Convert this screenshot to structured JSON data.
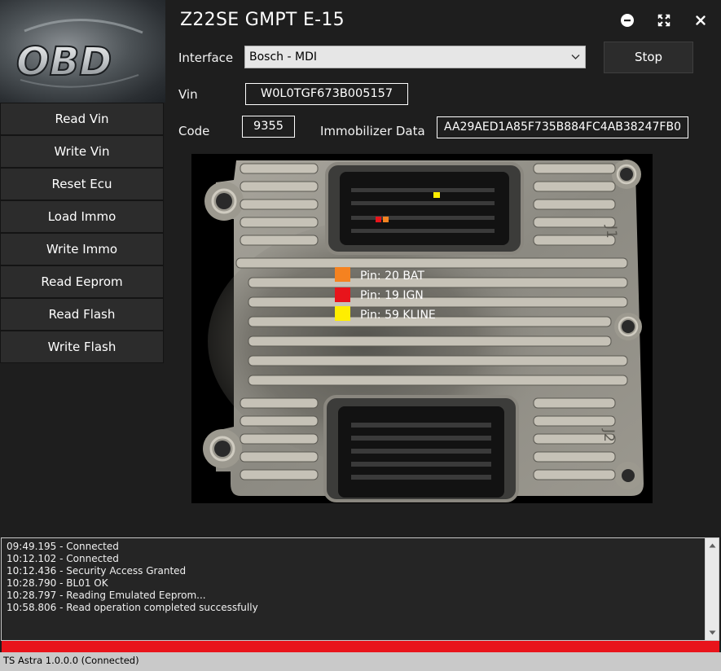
{
  "window": {
    "title": "Z22SE GMPT E-15",
    "minimize_icon": "minimize-circle-icon",
    "maximize_icon": "expand-arrows-icon",
    "close_icon": "close-x-icon"
  },
  "logo": {
    "text": "OBD"
  },
  "sidebar": {
    "items": [
      {
        "label": "Read Vin"
      },
      {
        "label": "Write Vin"
      },
      {
        "label": "Reset Ecu"
      },
      {
        "label": "Load Immo"
      },
      {
        "label": "Write Immo"
      },
      {
        "label": "Read Eeprom"
      },
      {
        "label": "Read Flash"
      },
      {
        "label": "Write Flash"
      }
    ]
  },
  "form": {
    "interface_label": "Interface",
    "interface_value": "Bosch - MDI",
    "stop_label": "Stop",
    "vin_label": "Vin",
    "vin_value": "W0L0TGF673B005157",
    "code_label": "Code",
    "code_value": "9355",
    "immo_label": "Immobilizer Data",
    "immo_value": "AA29AED1A85F735B884FC4AB38247FB0"
  },
  "ecu": {
    "connector_labels": [
      "J1",
      "J2"
    ],
    "legend": [
      {
        "label": "Pin: 20 BAT",
        "color": "#f58220"
      },
      {
        "label": "Pin: 19 IGN",
        "color": "#e8141b"
      },
      {
        "label": "Pin: 59 KLINE",
        "color": "#ffee00"
      }
    ]
  },
  "log": {
    "lines": [
      "09:49.195 - Connected",
      "10:12.102 - Connected",
      "10:12.436 - Security Access Granted",
      "10:28.790 - BL01 OK",
      "10:28.797 - Reading Emulated Eeprom...",
      "10:58.806 - Read operation completed successfully"
    ]
  },
  "progress": {
    "fraction": 1.0,
    "color": "#e8141b"
  },
  "status": {
    "text": "TS Astra 1.0.0.0 (Connected)"
  }
}
